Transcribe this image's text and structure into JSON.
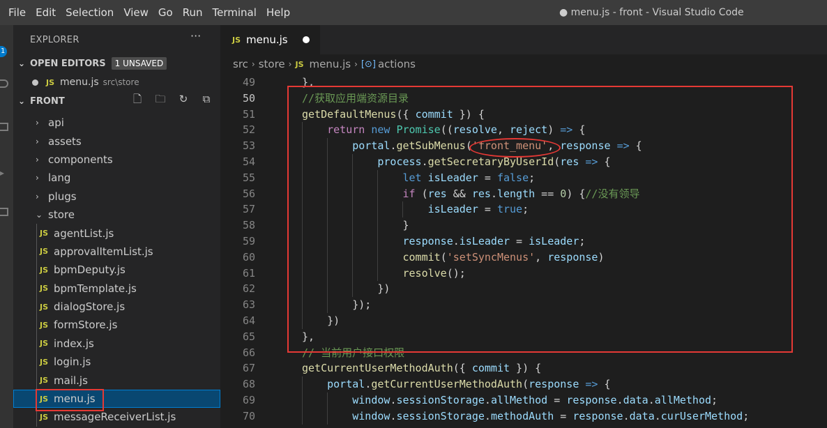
{
  "menubar": {
    "items": [
      "File",
      "Edit",
      "Selection",
      "View",
      "Go",
      "Run",
      "Terminal",
      "Help"
    ],
    "window_title": "● menu.js - front - Visual Studio Code"
  },
  "activity": {
    "badge": "1"
  },
  "sidebar": {
    "title": "EXPLORER",
    "more": "···",
    "open_editors": {
      "label": "OPEN EDITORS",
      "badge": "1 UNSAVED",
      "file": {
        "icon": "JS",
        "name": "menu.js",
        "path": "src\\store"
      }
    },
    "front": {
      "label": "FRONT"
    },
    "folders": [
      "api",
      "assets",
      "components",
      "lang",
      "plugs",
      "store"
    ],
    "files": [
      "agentList.js",
      "approvalItemList.js",
      "bpmDeputy.js",
      "bpmTemplate.js",
      "dialogStore.js",
      "formStore.js",
      "index.js",
      "login.js",
      "mail.js",
      "menu.js",
      "messageReceiverList.js"
    ],
    "selected_file": "menu.js",
    "file_icon": "JS"
  },
  "editor": {
    "tab": {
      "icon": "JS",
      "label": "menu.js"
    },
    "breadcrumb": {
      "part1": "src",
      "part2": "store",
      "icon": "JS",
      "file": "menu.js",
      "symbol_icon": "[⊙]",
      "symbol": "actions"
    },
    "line_numbers": [
      49,
      50,
      51,
      52,
      53,
      54,
      55,
      56,
      57,
      58,
      59,
      60,
      61,
      62,
      63,
      64,
      65,
      66,
      67,
      68,
      69,
      70
    ],
    "active_line": 50
  },
  "colors": {
    "highlight": "#e53935",
    "accent": "#007acc",
    "selection": "#094771"
  }
}
